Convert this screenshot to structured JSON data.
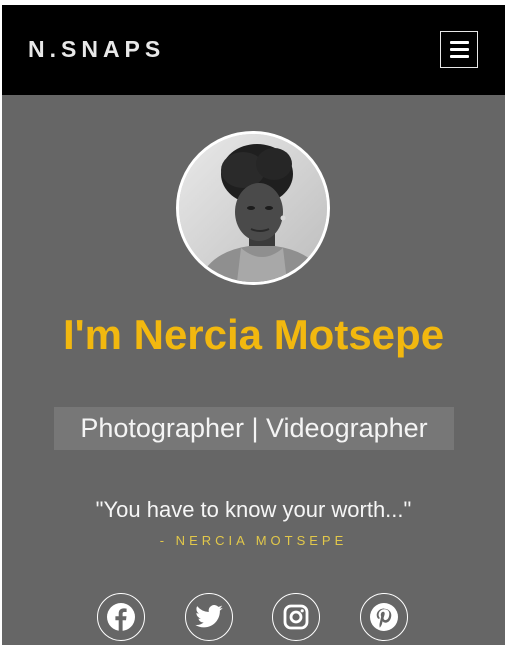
{
  "header": {
    "brand": "N.SNAPS",
    "menu_icon": "hamburger-icon"
  },
  "hero": {
    "name": "I'm Nercia Motsepe",
    "role": "Photographer | Videographer",
    "quote": "\"You have to know your worth...\"",
    "attribution": "- NERCIA MOTSEPE"
  },
  "social": [
    {
      "icon": "facebook-icon"
    },
    {
      "icon": "twitter-icon"
    },
    {
      "icon": "instagram-icon"
    },
    {
      "icon": "pinterest-icon"
    }
  ],
  "colors": {
    "accent": "#f2b80f",
    "attribution": "#e2c84a",
    "background": "#666666",
    "navbar": "#000000"
  }
}
